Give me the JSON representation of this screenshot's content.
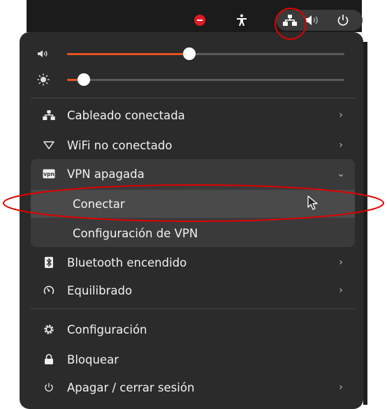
{
  "panel": {
    "icons": [
      "do-not-disturb-icon",
      "accessibility-icon",
      "network-wired-icon",
      "volume-icon",
      "power-icon"
    ]
  },
  "sliders": {
    "volume": {
      "icon": "volume-icon",
      "level": 0.44
    },
    "brightness": {
      "icon": "brightness-icon",
      "level": 0.06
    }
  },
  "menu": {
    "wired": {
      "label": "Cableado conectada"
    },
    "wifi": {
      "label": "WiFi no conectado"
    },
    "vpn": {
      "label": "VPN apagada"
    },
    "vpn_connect": {
      "label": "Conectar"
    },
    "vpn_settings": {
      "label": "Configuración de VPN"
    },
    "bluetooth": {
      "label": "Bluetooth encendido"
    },
    "power_mode": {
      "label": "Equilibrado"
    },
    "settings": {
      "label": "Configuración"
    },
    "lock": {
      "label": "Bloquear"
    },
    "power_off": {
      "label": "Apagar / cerrar sesión"
    }
  },
  "colors": {
    "accent": "#e95420",
    "annotation": "#e00000",
    "menu_bg": "#2b2b2b",
    "hover_bg": "#4a4a4a"
  }
}
